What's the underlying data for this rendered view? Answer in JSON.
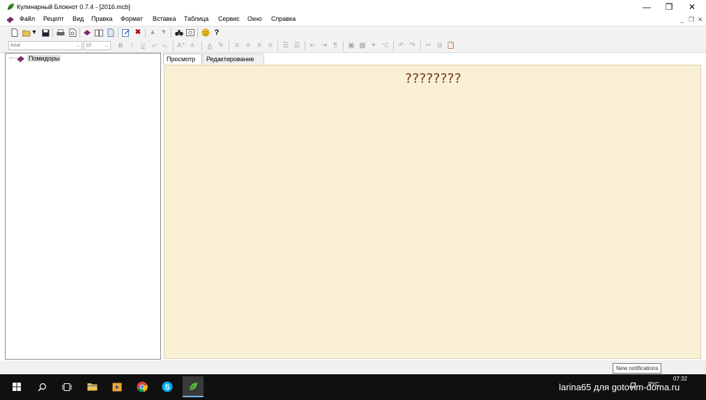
{
  "window": {
    "title": "Кулинарный Блокнот 0.7.4 - [2016.mcb]",
    "controls": {
      "minimize": "—",
      "restore": "❐",
      "close": "✕"
    }
  },
  "menu": {
    "items": [
      "Файл",
      "Рецепт",
      "Вид",
      "Правка",
      "Формат",
      "Вставка",
      "Таблица",
      "Сервис",
      "Окно",
      "Справка"
    ],
    "mdi_controls": {
      "minimize": "_",
      "restore": "❐",
      "close": "✕"
    }
  },
  "toolbar": {
    "font_name": "Arial",
    "font_size": "10"
  },
  "tree": {
    "items": [
      {
        "label": "Помидоры",
        "icon": "book-icon"
      }
    ]
  },
  "tabs": {
    "view": "Просмотр",
    "edit": "Редактирование"
  },
  "content": {
    "recipe_title": "????????"
  },
  "status": {
    "notification": "New notifications"
  },
  "taskbar": {
    "watermark": "larina65 для gotovim-doma.ru",
    "language": "РУС",
    "time": "07:32"
  },
  "colors": {
    "content_bg": "#f9f0d6",
    "title_text": "#7a3b16",
    "taskbar_bg": "#101010"
  }
}
